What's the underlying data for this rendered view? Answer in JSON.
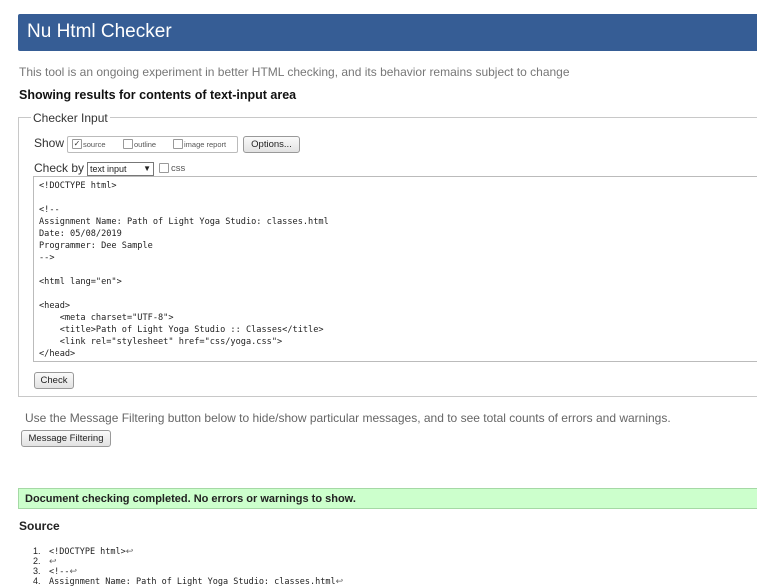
{
  "header": {
    "title": "Nu Html Checker"
  },
  "tagline": "This tool is an ongoing experiment in better HTML checking, and its behavior remains subject to change",
  "results_heading": "Showing results for contents of text-input area",
  "checker_input": {
    "legend": "Checker Input",
    "show_label": "Show",
    "show_options": [
      {
        "label": "source",
        "checked": true
      },
      {
        "label": "outline",
        "checked": false
      },
      {
        "label": "image report",
        "checked": false
      }
    ],
    "options_button": "Options...",
    "checkby_label": "Check by",
    "checkby_value": "text input",
    "css_label": "css",
    "css_checked": false,
    "textarea_lines": [
      "<!DOCTYPE html>",
      "",
      "<!--",
      "Assignment Name: Path of Light Yoga Studio: classes.html",
      "Date: 05/08/2019",
      "Programmer: Dee Sample",
      "-->",
      "",
      "<html lang=\"en\">",
      "",
      "<head>",
      "    <meta charset=\"UTF-8\">",
      "    <title>Path of Light Yoga Studio :: Classes</title>",
      "    <link rel=\"stylesheet\" href=\"css/yoga.css\">",
      "</head>"
    ],
    "check_button": "Check"
  },
  "filter_note": "Use the Message Filtering button below to hide/show particular messages, and to see total counts of errors and warnings.",
  "filter_button": "Message Filtering",
  "status_message": "Document checking completed. No errors or warnings to show.",
  "colors": {
    "header_bg": "#365d95",
    "success_bg": "#ccffcc"
  },
  "source": {
    "heading": "Source",
    "lines": [
      {
        "num": "1.",
        "text": "<!DOCTYPE html>"
      },
      {
        "num": "2.",
        "text": ""
      },
      {
        "num": "3.",
        "text": "<!--"
      },
      {
        "num": "4.",
        "text": "Assignment Name: Path of Light Yoga Studio: classes.html"
      }
    ],
    "return_icon": "↩"
  }
}
